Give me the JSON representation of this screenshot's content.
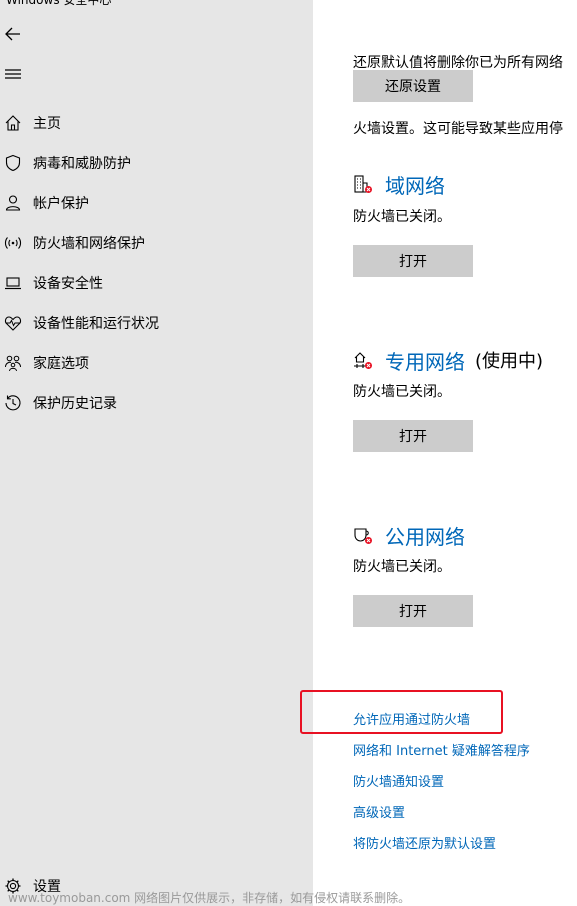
{
  "window": {
    "title": "Windows 安全中心"
  },
  "sidebar": {
    "back_icon": "back-arrow-icon",
    "menu_icon": "hamburger-menu-icon",
    "items": [
      {
        "label": "主页",
        "icon": "home-icon"
      },
      {
        "label": "病毒和威胁防护",
        "icon": "shield-icon"
      },
      {
        "label": "帐户保护",
        "icon": "person-icon"
      },
      {
        "label": "防火墙和网络保护",
        "icon": "wifi-signal-icon"
      },
      {
        "label": "设备安全性",
        "icon": "laptop-icon"
      },
      {
        "label": "设备性能和运行状况",
        "icon": "heart-pulse-icon"
      },
      {
        "label": "家庭选项",
        "icon": "family-icon"
      },
      {
        "label": "保护历史记录",
        "icon": "history-icon"
      }
    ],
    "settings": {
      "label": "设置",
      "icon": "gear-icon"
    }
  },
  "main": {
    "restore_text_line1": "还原默认值将删除你已为所有网络",
    "restore_text_line2": "火墙设置。这可能导致某些应用停",
    "restore_button": "还原设置",
    "networks": [
      {
        "title": "域网络",
        "suffix": "",
        "status": "防火墙已关闭。",
        "button": "打开",
        "icon": "domain-network-icon"
      },
      {
        "title": "专用网络",
        "suffix": "(使用中)",
        "status": "防火墙已关闭。",
        "button": "打开",
        "icon": "private-network-icon"
      },
      {
        "title": "公用网络",
        "suffix": "",
        "status": "防火墙已关闭。",
        "button": "打开",
        "icon": "public-network-icon"
      }
    ],
    "links": [
      "允许应用通过防火墙",
      "网络和 Internet 疑难解答程序",
      "防火墙通知设置",
      "高级设置",
      "将防火墙还原为默认设置"
    ]
  },
  "watermark": "www.toymoban.com 网络图片仅供展示，非存储，如有侵权请联系删除。",
  "colors": {
    "sidebar_bg": "#e6e6e6",
    "link": "#0067b8",
    "button_bg": "#cccccc",
    "highlight": "#e81123",
    "alert": "#e81123"
  }
}
